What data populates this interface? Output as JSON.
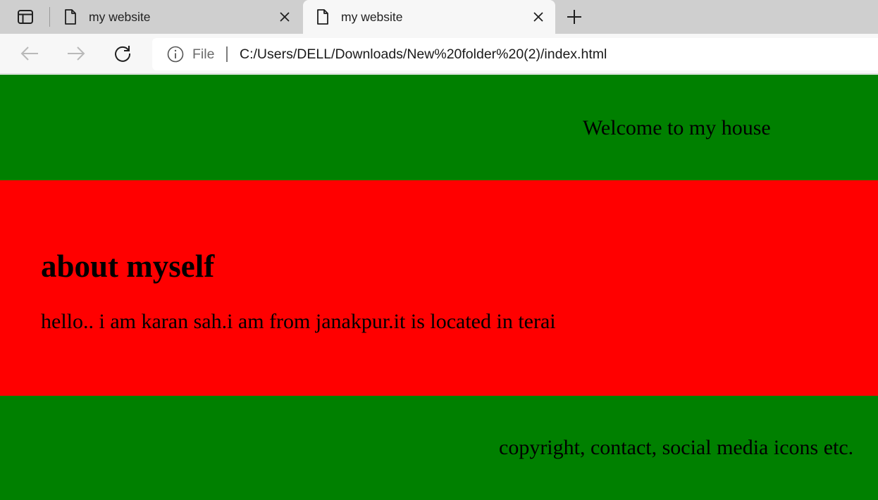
{
  "browser": {
    "tabs": [
      {
        "title": "my website",
        "active": false,
        "icon": "page-icon"
      },
      {
        "title": "my website",
        "active": true,
        "icon": "page-icon"
      }
    ],
    "address_bar": {
      "scheme_label": "File",
      "url": "C:/Users/DELL/Downloads/New%20folder%20(2)/index.html"
    },
    "icons": {
      "tab_actions": "tab-actions-icon",
      "close": "close-icon",
      "new_tab": "plus-icon",
      "back": "back-arrow-icon",
      "forward": "forward-arrow-icon",
      "reload": "reload-icon",
      "info": "info-icon"
    }
  },
  "page": {
    "header": {
      "text": "Welcome to my house",
      "background": "#008000"
    },
    "about": {
      "heading": "about myself",
      "text": "hello.. i am karan sah.i am from janakpur.it is located in terai",
      "background": "#ff0000"
    },
    "footer": {
      "text": "copyright, contact, social media icons etc.",
      "background": "#008000"
    }
  }
}
